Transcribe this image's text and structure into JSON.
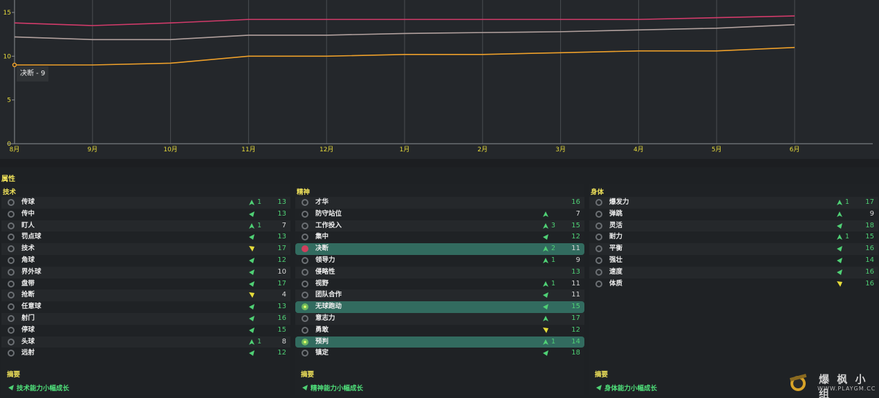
{
  "chart_data": {
    "type": "line",
    "x": [
      "8月",
      "9月",
      "10月",
      "11月",
      "12月",
      "1月",
      "2月",
      "3月",
      "4月",
      "5月",
      "6月"
    ],
    "ylim": [
      0,
      15
    ],
    "yticks": [
      0,
      5,
      10,
      15
    ],
    "grid": true,
    "series": [
      {
        "color": "#d43b6b",
        "values": [
          13.8,
          13.5,
          13.8,
          14.2,
          14.2,
          14.2,
          14.2,
          14.2,
          14.2,
          14.4,
          14.6
        ]
      },
      {
        "color": "#b3a29f",
        "values": [
          12.2,
          11.9,
          11.9,
          12.4,
          12.4,
          12.6,
          12.7,
          12.8,
          13.0,
          13.2,
          13.6
        ]
      },
      {
        "color": "#f0a12a",
        "values": [
          9,
          9,
          9.2,
          10,
          10,
          10.2,
          10.2,
          10.4,
          10.6,
          10.6,
          11.0
        ]
      }
    ],
    "tooltip": "决断 - 9"
  },
  "attributes": {
    "title": "属性",
    "technical": {
      "title": "技术",
      "rows": [
        {
          "label": "传球",
          "arrow": "up",
          "change": "1",
          "value": "13",
          "vcolor": "#4fd175"
        },
        {
          "label": "传中",
          "arrow": "upright",
          "change": "",
          "value": "13",
          "vcolor": "#4fd175"
        },
        {
          "label": "盯人",
          "arrow": "up",
          "change": "1",
          "value": "7",
          "vcolor": "#d8d8d8"
        },
        {
          "label": "罚点球",
          "arrow": "upright",
          "change": "",
          "value": "13",
          "vcolor": "#4fd175"
        },
        {
          "label": "技术",
          "arrow": "down",
          "change": "",
          "value": "17",
          "vcolor": "#4fd175"
        },
        {
          "label": "角球",
          "arrow": "upright",
          "change": "",
          "value": "12",
          "vcolor": "#4fd175"
        },
        {
          "label": "界外球",
          "arrow": "upright",
          "change": "",
          "value": "10",
          "vcolor": "#d8d8d8"
        },
        {
          "label": "盘带",
          "arrow": "upright",
          "change": "",
          "value": "17",
          "vcolor": "#4fd175"
        },
        {
          "label": "抢断",
          "arrow": "down",
          "change": "",
          "value": "4",
          "vcolor": "#d8d8d8"
        },
        {
          "label": "任意球",
          "arrow": "upright",
          "change": "",
          "value": "13",
          "vcolor": "#4fd175"
        },
        {
          "label": "射门",
          "arrow": "upright",
          "change": "",
          "value": "16",
          "vcolor": "#4fd175"
        },
        {
          "label": "停球",
          "arrow": "upright",
          "change": "",
          "value": "15",
          "vcolor": "#4fd175"
        },
        {
          "label": "头球",
          "arrow": "up",
          "change": "1",
          "value": "8",
          "vcolor": "#d8d8d8"
        },
        {
          "label": "远射",
          "arrow": "upright",
          "change": "",
          "value": "12",
          "vcolor": "#4fd175"
        }
      ],
      "summary_title": "摘要",
      "summary": "技术能力小幅成长"
    },
    "mental": {
      "title": "精神",
      "rows": [
        {
          "label": "才华",
          "arrow": "",
          "change": "",
          "value": "16",
          "vcolor": "#4fd175"
        },
        {
          "label": "防守站位",
          "arrow": "up",
          "change": "",
          "value": "7",
          "vcolor": "#d8d8d8"
        },
        {
          "label": "工作投入",
          "arrow": "up",
          "change": "3",
          "value": "15",
          "vcolor": "#4fd175"
        },
        {
          "label": "集中",
          "arrow": "upright",
          "change": "",
          "value": "12",
          "vcolor": "#4fd175"
        },
        {
          "label": "决断",
          "arrow": "up",
          "change": "2",
          "value": "11",
          "vcolor": "#d8d8d8",
          "hl": true,
          "icon": "flag-red"
        },
        {
          "label": "领导力",
          "arrow": "up",
          "change": "1",
          "value": "9",
          "vcolor": "#d8d8d8"
        },
        {
          "label": "侵略性",
          "arrow": "",
          "change": "",
          "value": "13",
          "vcolor": "#4fd175"
        },
        {
          "label": "视野",
          "arrow": "up",
          "change": "1",
          "value": "11",
          "vcolor": "#d8d8d8"
        },
        {
          "label": "团队合作",
          "arrow": "upright",
          "change": "",
          "value": "11",
          "vcolor": "#d8d8d8"
        },
        {
          "label": "无球跑动",
          "arrow": "upright",
          "change": "",
          "value": "15",
          "vcolor": "#4fd175",
          "hl": true,
          "icon": "flag-green"
        },
        {
          "label": "意志力",
          "arrow": "up",
          "change": "",
          "value": "17",
          "vcolor": "#4fd175"
        },
        {
          "label": "勇敢",
          "arrow": "down",
          "change": "",
          "value": "12",
          "vcolor": "#4fd175"
        },
        {
          "label": "预判",
          "arrow": "up",
          "change": "1",
          "value": "14",
          "vcolor": "#4fd175",
          "hl": true,
          "icon": "flag-green"
        },
        {
          "label": "镇定",
          "arrow": "upright",
          "change": "",
          "value": "18",
          "vcolor": "#4fd175"
        }
      ],
      "summary_title": "摘要",
      "summary": "精神能力小幅成长"
    },
    "physical": {
      "title": "身体",
      "rows": [
        {
          "label": "爆发力",
          "arrow": "up",
          "change": "1",
          "value": "17",
          "vcolor": "#4fd175"
        },
        {
          "label": "弹跳",
          "arrow": "up",
          "change": "",
          "value": "9",
          "vcolor": "#d8d8d8"
        },
        {
          "label": "灵活",
          "arrow": "upright",
          "change": "",
          "value": "18",
          "vcolor": "#4fd175"
        },
        {
          "label": "耐力",
          "arrow": "up",
          "change": "1",
          "value": "15",
          "vcolor": "#4fd175"
        },
        {
          "label": "平衡",
          "arrow": "upright",
          "change": "",
          "value": "16",
          "vcolor": "#4fd175"
        },
        {
          "label": "强壮",
          "arrow": "upright",
          "change": "",
          "value": "14",
          "vcolor": "#4fd175"
        },
        {
          "label": "速度",
          "arrow": "upright",
          "change": "",
          "value": "16",
          "vcolor": "#4fd175"
        },
        {
          "label": "体质",
          "arrow": "down",
          "change": "",
          "value": "16",
          "vcolor": "#4fd175"
        }
      ],
      "summary_title": "摘要",
      "summary": "身体能力小幅成长"
    }
  },
  "watermark": {
    "main": "爆 枫 小 组",
    "sub": "WWW.PLAYGM.CC"
  }
}
